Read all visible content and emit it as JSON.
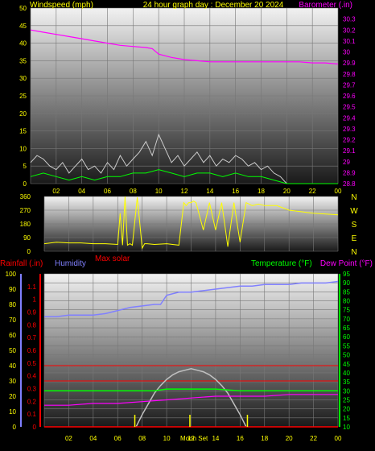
{
  "header": {
    "left_label": "Windspeed (mph)",
    "title": "24 hour graph day : December 20 2024",
    "right_label": "Barometer (.in)"
  },
  "colors": {
    "wind": "#ffffff",
    "gust": "#cccccc",
    "wind_avg": "#00ff00",
    "barometer": "#ff00ff",
    "direction": "#ffff00",
    "title": "#ffff00",
    "rainfall": "#ff0000",
    "humidity": "#8080ff",
    "temperature": "#00ff00",
    "dewpoint": "#ff00ff",
    "solar": "#c0c0c0",
    "max_solar": "#ff0000",
    "moon": "#ffff00"
  },
  "chart_data": [
    {
      "type": "line",
      "id": "wind_barometer",
      "title": "24 hour graph day : December 20 2024",
      "ylabel": "Windspeed (mph)",
      "y2label": "Barometer (.in)",
      "ylim": [
        0,
        50
      ],
      "y2lim": [
        28.8,
        30.4
      ],
      "yticks": [
        0,
        5,
        10,
        15,
        20,
        25,
        30,
        35,
        40,
        45,
        50
      ],
      "y2ticks": [
        "28.8",
        "28.9",
        "29",
        "29.1",
        "29.2",
        "29.3",
        "29.4",
        "29.5",
        "29.6",
        "29.7",
        "29.8",
        "29.9",
        "30",
        "30.1",
        "30.2",
        "30.3"
      ],
      "xticks": [
        "02",
        "04",
        "06",
        "08",
        "10",
        "12",
        "14",
        "16",
        "18",
        "20",
        "22",
        "00"
      ],
      "series": [
        {
          "name": "Barometer",
          "axis": "y2",
          "x": [
            0,
            1,
            2,
            3,
            4,
            5,
            6,
            7,
            8,
            9,
            9.5,
            10,
            11,
            12,
            13,
            14,
            15,
            16,
            17,
            18,
            19,
            20,
            21,
            22,
            23,
            24
          ],
          "y": [
            30.2,
            30.18,
            30.16,
            30.14,
            30.12,
            30.1,
            30.08,
            30.06,
            30.05,
            30.04,
            30.03,
            29.98,
            29.95,
            29.93,
            29.92,
            29.91,
            29.91,
            29.91,
            29.91,
            29.91,
            29.91,
            29.91,
            29.91,
            29.9,
            29.9,
            29.89
          ]
        },
        {
          "name": "Wind gust",
          "axis": "y",
          "x": [
            0,
            0.5,
            1,
            1.5,
            2,
            2.5,
            3,
            3.5,
            4,
            4.5,
            5,
            5.5,
            6,
            6.5,
            7,
            7.5,
            8,
            8.5,
            9,
            9.5,
            10,
            10.5,
            11,
            11.5,
            12,
            12.5,
            13,
            13.5,
            14,
            14.5,
            15,
            15.5,
            16,
            16.5,
            17,
            17.5,
            18,
            18.5,
            19,
            19.5,
            20
          ],
          "y": [
            6,
            8,
            7,
            5,
            4,
            6,
            3,
            5,
            7,
            4,
            5,
            3,
            6,
            4,
            8,
            5,
            7,
            9,
            12,
            8,
            14,
            10,
            6,
            8,
            5,
            7,
            9,
            6,
            8,
            5,
            7,
            6,
            8,
            7,
            5,
            6,
            4,
            5,
            3,
            2,
            0
          ]
        },
        {
          "name": "Wind average",
          "axis": "y",
          "x": [
            0,
            1,
            2,
            3,
            4,
            5,
            6,
            7,
            8,
            9,
            10,
            11,
            12,
            13,
            14,
            15,
            16,
            17,
            18,
            19,
            20,
            24
          ],
          "y": [
            2,
            3,
            2,
            1,
            2,
            1,
            2,
            2,
            3,
            3,
            4,
            3,
            2,
            3,
            3,
            2,
            3,
            2,
            2,
            1,
            0,
            0
          ]
        }
      ]
    },
    {
      "type": "line",
      "id": "wind_direction",
      "ylim": [
        0,
        360
      ],
      "yticks": [
        0,
        90,
        180,
        270,
        360
      ],
      "ytick_labels": [
        "0",
        "90",
        "180",
        "270",
        "360"
      ],
      "compass": [
        "N",
        "W",
        "S",
        "E",
        "N"
      ],
      "series": [
        {
          "name": "Wind direction",
          "x": [
            0,
            1,
            2,
            3,
            4,
            5,
            6,
            6.2,
            6.4,
            6.6,
            6.8,
            7,
            7.2,
            7.6,
            8,
            8.2,
            8.4,
            9,
            10,
            11,
            11.4,
            11.6,
            11.8,
            12,
            12.2,
            12.4,
            13,
            13.5,
            14,
            14.5,
            15,
            15.5,
            16,
            16.5,
            17,
            17.5,
            18,
            19,
            20,
            21,
            22,
            23,
            24
          ],
          "y": [
            50,
            60,
            55,
            55,
            50,
            50,
            45,
            250,
            40,
            360,
            40,
            50,
            40,
            355,
            20,
            50,
            50,
            45,
            50,
            40,
            320,
            300,
            320,
            320,
            330,
            320,
            140,
            320,
            140,
            320,
            30,
            320,
            60,
            320,
            300,
            310,
            300,
            300,
            270,
            260,
            250,
            245,
            240
          ]
        }
      ]
    },
    {
      "type": "line",
      "id": "rain_humidity_temp",
      "labels": {
        "rainfall": "Rainfall (.in)",
        "humidity": "Humidity",
        "max_solar": "Max solar",
        "temperature": "Temperature (°F)",
        "dewpoint": "Dew Point (°F)",
        "moon": "Moon Set"
      },
      "humidity_ylim": [
        0,
        100
      ],
      "humidity_ticks": [
        0,
        10,
        20,
        30,
        40,
        50,
        60,
        70,
        80,
        90,
        100
      ],
      "rain_ylim": [
        0,
        1.2
      ],
      "rain_ticks": [
        "0",
        "0.1",
        "0.2",
        "0.3",
        "0.4",
        "0.5",
        "0.6",
        "0.7",
        "0.8",
        "0.9",
        "1",
        "1.1"
      ],
      "temp_ylim": [
        10,
        95
      ],
      "temp_ticks": [
        10,
        15,
        20,
        25,
        30,
        35,
        40,
        45,
        50,
        55,
        60,
        65,
        70,
        75,
        80,
        85,
        90,
        95
      ],
      "xticks": [
        "02",
        "04",
        "06",
        "08",
        "10",
        "12",
        "14",
        "16",
        "18",
        "20",
        "22",
        "00"
      ],
      "series": [
        {
          "name": "Humidity",
          "axis": "humidity",
          "x": [
            0,
            1,
            2,
            3,
            4,
            5,
            6,
            7,
            8,
            9,
            9.5,
            10,
            11,
            12,
            13,
            14,
            15,
            16,
            17,
            18,
            19,
            20,
            21,
            22,
            23,
            24
          ],
          "y": [
            72,
            72,
            73,
            73,
            73,
            74,
            76,
            78,
            79,
            80,
            80,
            86,
            88,
            88,
            89,
            90,
            91,
            92,
            92,
            93,
            93,
            93,
            94,
            94,
            94,
            95
          ]
        },
        {
          "name": "Temperature",
          "axis": "temp",
          "x": [
            0,
            2,
            4,
            6,
            8,
            9,
            10,
            11,
            12,
            13,
            14,
            16,
            18,
            20,
            22,
            24
          ],
          "y": [
            30,
            30,
            30,
            30,
            30,
            30,
            31,
            31,
            31,
            31,
            31,
            30,
            30,
            30,
            30,
            30
          ]
        },
        {
          "name": "Dew Point",
          "axis": "temp",
          "x": [
            0,
            2,
            4,
            6,
            8,
            10,
            12,
            14,
            16,
            18,
            20,
            22,
            24
          ],
          "y": [
            22,
            22,
            23,
            23,
            24,
            25,
            26,
            27,
            27,
            27,
            28,
            28,
            28
          ]
        },
        {
          "name": "Rainfall",
          "axis": "rain",
          "x": [
            0,
            24
          ],
          "y": [
            0,
            0
          ]
        },
        {
          "name": "Solar",
          "axis": "humidity",
          "x": [
            7.5,
            8,
            8.5,
            9,
            9.5,
            10,
            10.5,
            11,
            11.5,
            12,
            12.5,
            13,
            13.5,
            14,
            14.5,
            15,
            15.5,
            16,
            16.5
          ],
          "y": [
            0,
            8,
            15,
            22,
            27,
            31,
            34,
            36,
            37,
            38,
            37,
            36,
            34,
            31,
            27,
            22,
            15,
            8,
            0
          ]
        }
      ],
      "reference_lines": [
        {
          "axis": "humidity",
          "value": 40,
          "color": "#ff0000"
        },
        {
          "axis": "humidity",
          "value": 30,
          "color": "#ff0000"
        }
      ],
      "markers": [
        {
          "label": "sunrise",
          "x": 7.4
        },
        {
          "label": "sunset",
          "x": 16.6
        },
        {
          "label": "Moon Set",
          "x": 11.9
        }
      ]
    }
  ]
}
